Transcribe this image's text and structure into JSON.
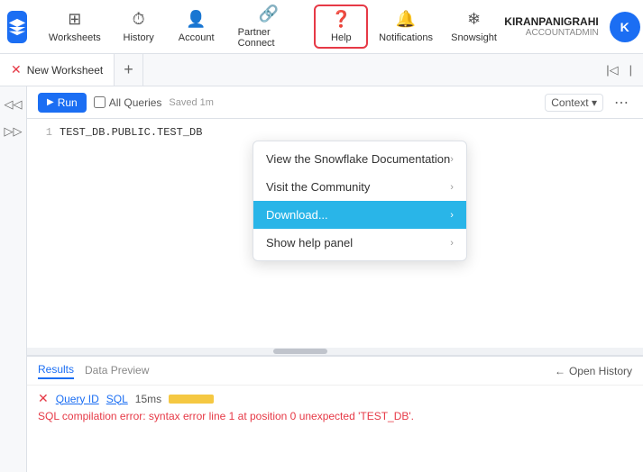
{
  "app": {
    "title": "Snowflake"
  },
  "nav": {
    "worksheets_label": "Worksheets",
    "history_label": "History",
    "account_label": "Account",
    "partner_connect_label": "Partner Connect",
    "help_label": "Help",
    "notifications_label": "Notifications",
    "snowsight_label": "Snowsight"
  },
  "user": {
    "name": "KIRANPANIGRAHI",
    "role": "ACCOUNTADMIN",
    "initials": "K"
  },
  "worksheet": {
    "tab_label": "New Worksheet",
    "add_label": "+",
    "run_label": "Run",
    "all_queries_label": "All Queries",
    "saved_label": "Saved 1m",
    "context_label": "Context",
    "line1": "TEST_DB.PUBLIC.TEST_DB"
  },
  "dropdown": {
    "item1_label": "View the Snowflake Documentation",
    "item2_label": "Visit the Community",
    "item3_label": "Download...",
    "item4_label": "Show help panel"
  },
  "bottom": {
    "results_tab": "Results",
    "data_preview_tab": "Data Preview",
    "open_history_label": "Open History",
    "query_id_label": "Query ID",
    "sql_label": "SQL",
    "time_label": "15ms",
    "error_msg": "SQL compilation error: syntax error line 1 at position 0 unexpected 'TEST_DB'."
  }
}
